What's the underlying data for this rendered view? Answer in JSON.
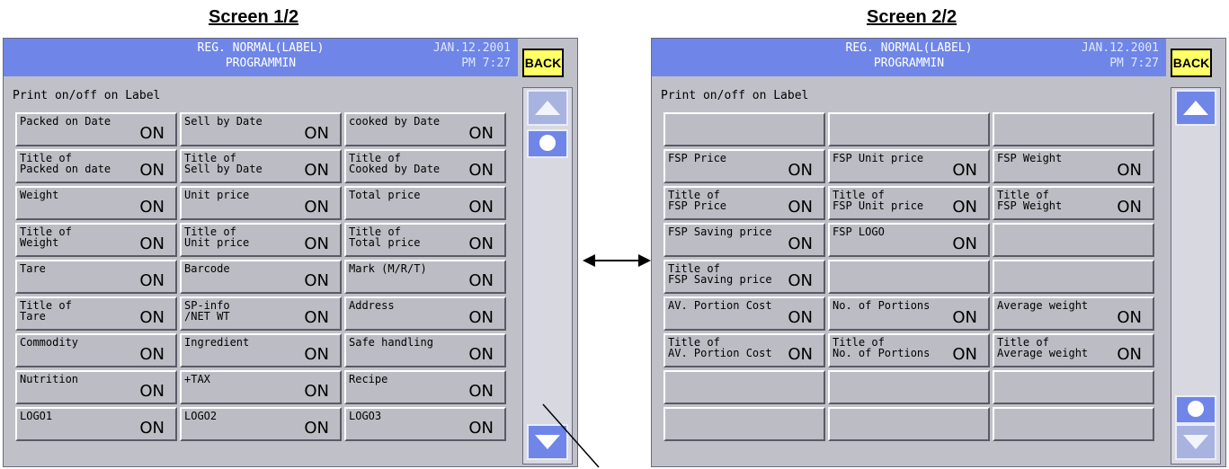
{
  "captions": {
    "left": "Screen 1/2",
    "right": "Screen 2/2"
  },
  "screens": [
    {
      "header": {
        "title1": "REG. NORMAL(LABEL)",
        "title2": "PROGRAMMIN",
        "date": "JAN.12.2001",
        "time": "PM 7:27"
      },
      "back_label": "BACK",
      "subtitle": "Print on/off on Label",
      "rows": [
        [
          {
            "label": "Packed on Date",
            "state": "ON"
          },
          {
            "label": "Sell by Date",
            "state": "ON"
          },
          {
            "label": "cooked by Date",
            "state": "ON"
          }
        ],
        [
          {
            "label": "Title of\nPacked on date",
            "state": "ON"
          },
          {
            "label": "Title of\nSell by Date",
            "state": "ON"
          },
          {
            "label": "Title of\nCooked by Date",
            "state": "ON"
          }
        ],
        [
          {
            "label": "Weight",
            "state": "ON"
          },
          {
            "label": "Unit price",
            "state": "ON"
          },
          {
            "label": "Total price",
            "state": "ON"
          }
        ],
        [
          {
            "label": "Title of\nWeight",
            "state": "ON"
          },
          {
            "label": "Title of\nUnit price",
            "state": "ON"
          },
          {
            "label": "Title of\nTotal price",
            "state": "ON"
          }
        ],
        [
          {
            "label": "Tare",
            "state": "ON"
          },
          {
            "label": "Barcode",
            "state": "ON"
          },
          {
            "label": "Mark (M/R/T)",
            "state": "ON"
          }
        ],
        [
          {
            "label": "Title of\nTare",
            "state": "ON"
          },
          {
            "label": "SP-info\n/NET WT",
            "state": "ON"
          },
          {
            "label": "Address",
            "state": "ON"
          }
        ],
        [
          {
            "label": "Commodity",
            "state": "ON"
          },
          {
            "label": "Ingredient",
            "state": "ON"
          },
          {
            "label": "Safe handling",
            "state": "ON"
          }
        ],
        [
          {
            "label": "Nutrition",
            "state": "ON"
          },
          {
            "label": "+TAX",
            "state": "ON"
          },
          {
            "label": "Recipe",
            "state": "ON"
          }
        ],
        [
          {
            "label": "LOGO1",
            "state": "ON"
          },
          {
            "label": "LOGO2",
            "state": "ON"
          },
          {
            "label": "LOGO3",
            "state": "ON"
          }
        ]
      ]
    },
    {
      "header": {
        "title1": "REG. NORMAL(LABEL)",
        "title2": "PROGRAMMIN",
        "date": "JAN.12.2001",
        "time": "PM 7:27"
      },
      "back_label": "BACK",
      "subtitle": "Print on/off on Label",
      "rows": [
        [
          {
            "label": "",
            "state": ""
          },
          {
            "label": "",
            "state": ""
          },
          {
            "label": "",
            "state": ""
          }
        ],
        [
          {
            "label": "FSP Price",
            "state": "ON"
          },
          {
            "label": "FSP Unit price",
            "state": "ON"
          },
          {
            "label": "FSP Weight",
            "state": "ON"
          }
        ],
        [
          {
            "label": "Title of\nFSP Price",
            "state": "ON"
          },
          {
            "label": "Title of\nFSP Unit price",
            "state": "ON"
          },
          {
            "label": "Title of\nFSP Weight",
            "state": "ON"
          }
        ],
        [
          {
            "label": "FSP Saving price",
            "state": "ON"
          },
          {
            "label": "FSP LOGO",
            "state": "ON"
          },
          {
            "label": "",
            "state": ""
          }
        ],
        [
          {
            "label": "Title of\nFSP Saving price",
            "state": "ON"
          },
          {
            "label": "",
            "state": ""
          },
          {
            "label": "",
            "state": ""
          }
        ],
        [
          {
            "label": "AV. Portion Cost",
            "state": "ON"
          },
          {
            "label": "No. of Portions",
            "state": "ON"
          },
          {
            "label": "Average weight",
            "state": "ON"
          }
        ],
        [
          {
            "label": "Title of\nAV. Portion Cost",
            "state": "ON"
          },
          {
            "label": "Title of\nNo. of Portions",
            "state": "ON"
          },
          {
            "label": "Title of\nAverage weight",
            "state": "ON"
          }
        ],
        [
          {
            "label": "",
            "state": ""
          },
          {
            "label": "",
            "state": ""
          },
          {
            "label": "",
            "state": ""
          }
        ],
        [
          {
            "label": "",
            "state": ""
          },
          {
            "label": "",
            "state": ""
          },
          {
            "label": "",
            "state": ""
          }
        ]
      ]
    }
  ],
  "colors": {
    "header_bg": "#6f86e8",
    "back_bg": "#ffff66",
    "button_bg": "#bcbcc4",
    "panel_bg": "#c0c0c8"
  },
  "icons": {
    "scroll_up": "triangle-up-icon",
    "scroll_down": "triangle-down-icon",
    "scroll_thumb": "circle-icon",
    "arrow": "double-headed-arrow-icon"
  }
}
